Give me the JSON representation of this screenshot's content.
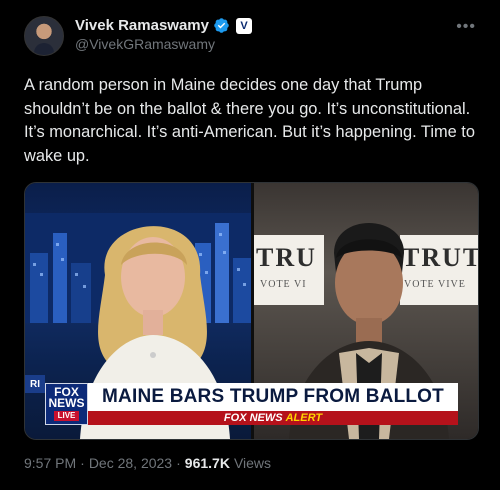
{
  "author": {
    "display_name": "Vivek Ramaswamy",
    "handle": "@VivekGRamaswamy",
    "verified": true,
    "affiliate_badge": "V"
  },
  "tweet": {
    "text": "A random person in Maine decides one day that Trump shouldn’t be on the ballot & there you go. It’s unconstitutional. It’s monarchical. It’s anti-American. But it’s happening. Time to wake up."
  },
  "media": {
    "left_edge_tag": "RI",
    "sign_text_big_1": "TRU",
    "sign_text_big_2": "TRUT",
    "sign_text_small_1": "VOTE VI",
    "sign_text_small_2": "VOTE VIVE",
    "logo_line1": "FOX",
    "logo_line2": "NEWS",
    "logo_live": "LIVE",
    "headline": "MAINE BARS TRUMP FROM BALLOT",
    "alert_prefix": "FOX NEWS",
    "alert_word": "ALERT"
  },
  "meta": {
    "time": "9:57 PM",
    "sep1": "·",
    "date": "Dec 28, 2023",
    "sep2": "·",
    "views_count": "961.7K",
    "views_label": "Views"
  },
  "colors": {
    "background": "#000000",
    "text": "#e7e9ea",
    "muted": "#71767b",
    "verified_blue": "#1d9bf0",
    "fox_red": "#b5121b",
    "fox_navy": "#0c2a78"
  }
}
